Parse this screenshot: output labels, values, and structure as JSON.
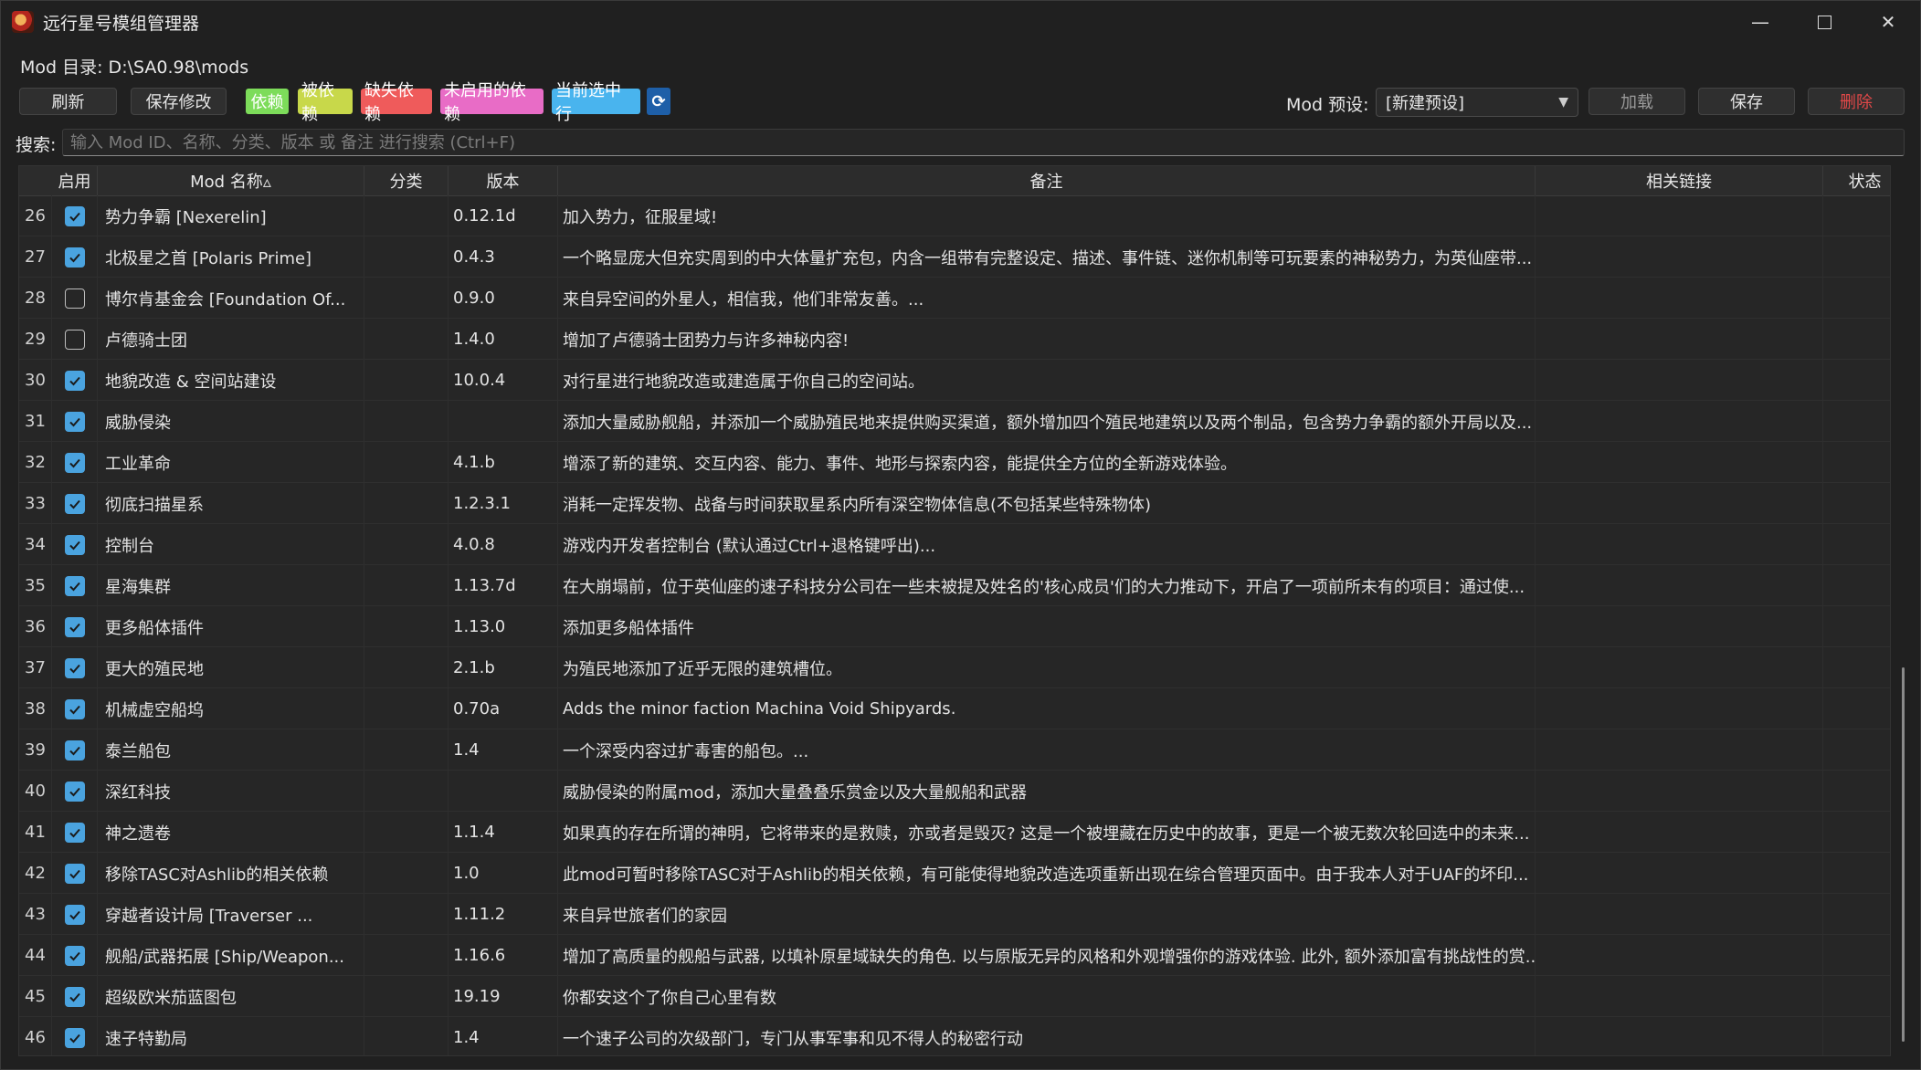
{
  "window": {
    "title": "远行星号模组管理器",
    "min_label": "—",
    "close_label": "✕"
  },
  "mod_dir": "Mod 目录: D:\\SA0.98\\mods",
  "toolbar": {
    "refresh_label": "刷新",
    "save_changes_label": "保存修改",
    "tags": [
      {
        "label": "依赖",
        "bg": "#7ddc5a",
        "fg": "#ffffff"
      },
      {
        "label": "被依赖",
        "bg": "#c8d84a",
        "fg": "#ffffff"
      },
      {
        "label": "缺失依赖",
        "bg": "#ef5b5b",
        "fg": "#ffffff"
      },
      {
        "label": "未启用的依赖",
        "bg": "#e86cc6",
        "fg": "#ffffff"
      },
      {
        "label": "当前选中行",
        "bg": "#49b4ee",
        "fg": "#ffffff"
      }
    ],
    "sync_icon": "refresh-icon"
  },
  "preset": {
    "label": "Mod 预设:",
    "selected": "[新建预设]",
    "load_label": "加载",
    "save_label": "保存",
    "delete_label": "删除",
    "delete_color": "#e04848"
  },
  "search": {
    "label": "搜索:",
    "placeholder": "输入 Mod ID、名称、分类、版本 或 备注 进行搜索 (Ctrl+F)"
  },
  "table": {
    "headers": {
      "enabled": "启用",
      "name": "Mod 名称▵",
      "category": "分类",
      "version": "版本",
      "note": "备注",
      "links": "相关链接",
      "status": "状态"
    },
    "rows": [
      {
        "idx": "26",
        "enabled": true,
        "name": "势力争霸 [Nexerelin]",
        "category": "",
        "version": "0.12.1d",
        "note": "加入势力，征服星域!",
        "links": "",
        "status": ""
      },
      {
        "idx": "27",
        "enabled": true,
        "name": "北极星之首 [Polaris Prime]",
        "category": "",
        "version": "0.4.3",
        "note": "一个略显庞大但充实周到的中大体量扩充包，内含一组带有完整设定、描述、事件链、迷你机制等可玩要素的神秘势力，为英仙座带...",
        "links": "",
        "status": ""
      },
      {
        "idx": "28",
        "enabled": false,
        "name": "博尔肯基金会 [Foundation Of...",
        "category": "",
        "version": "0.9.0",
        "note": "来自异空间的外星人，相信我，他们非常友善。...",
        "links": "",
        "status": ""
      },
      {
        "idx": "29",
        "enabled": false,
        "name": "卢德骑士团",
        "category": "",
        "version": "1.4.0",
        "note": "增加了卢德骑士团势力与许多神秘内容!",
        "links": "",
        "status": ""
      },
      {
        "idx": "30",
        "enabled": true,
        "name": "地貌改造 & 空间站建设",
        "category": "",
        "version": "10.0.4",
        "note": "对行星进行地貌改造或建造属于你自己的空间站。",
        "links": "",
        "status": ""
      },
      {
        "idx": "31",
        "enabled": true,
        "name": "威胁侵染",
        "category": "",
        "version": "",
        "note": "添加大量威胁舰船，并添加一个威胁殖民地来提供购买渠道，额外增加四个殖民地建筑以及两个制品，包含势力争霸的额外开局以及...",
        "links": "",
        "status": ""
      },
      {
        "idx": "32",
        "enabled": true,
        "name": "工业革命",
        "category": "",
        "version": "4.1.b",
        "note": "增添了新的建筑、交互内容、能力、事件、地形与探索内容，能提供全方位的全新游戏体验。",
        "links": "",
        "status": ""
      },
      {
        "idx": "33",
        "enabled": true,
        "name": "彻底扫描星系",
        "category": "",
        "version": "1.2.3.1",
        "note": "消耗一定挥发物、战备与时间获取星系内所有深空物体信息(不包括某些特殊物体)",
        "links": "",
        "status": ""
      },
      {
        "idx": "34",
        "enabled": true,
        "name": "控制台",
        "category": "",
        "version": "4.0.8",
        "note": "游戏内开发者控制台 (默认通过Ctrl+退格键呼出)...",
        "links": "",
        "status": ""
      },
      {
        "idx": "35",
        "enabled": true,
        "name": "星海集群",
        "category": "",
        "version": "1.13.7d",
        "note": "在大崩塌前，位于英仙座的速子科技分公司在一些未被提及姓名的'核心成员'们的大力推动下，开启了一项前所未有的项目：通过使...",
        "links": "",
        "status": ""
      },
      {
        "idx": "36",
        "enabled": true,
        "name": "更多船体插件",
        "category": "",
        "version": "1.13.0",
        "note": "添加更多船体插件",
        "links": "",
        "status": ""
      },
      {
        "idx": "37",
        "enabled": true,
        "name": "更大的殖民地",
        "category": "",
        "version": "2.1.b",
        "note": "为殖民地添加了近乎无限的建筑槽位。",
        "links": "",
        "status": ""
      },
      {
        "idx": "38",
        "enabled": true,
        "name": "机械虚空船坞",
        "category": "",
        "version": "0.70a",
        "note": "Adds the minor faction Machina Void Shipyards.",
        "links": "",
        "status": ""
      },
      {
        "idx": "39",
        "enabled": true,
        "name": "泰兰船包",
        "category": "",
        "version": "1.4",
        "note": "一个深受内容过扩毒害的船包。...",
        "links": "",
        "status": ""
      },
      {
        "idx": "40",
        "enabled": true,
        "name": "深红科技",
        "category": "",
        "version": "",
        "note": "威胁侵染的附属mod，添加大量叠叠乐赏金以及大量舰船和武器",
        "links": "",
        "status": ""
      },
      {
        "idx": "41",
        "enabled": true,
        "name": "神之遗卷",
        "category": "",
        "version": "1.1.4",
        "note": "如果真的存在所谓的神明，它将带来的是救赎，亦或者是毁灭? 这是一个被埋藏在历史中的故事，更是一个被无数次轮回选中的未来...",
        "links": "",
        "status": ""
      },
      {
        "idx": "42",
        "enabled": true,
        "name": "移除TASC对Ashlib的相关依赖",
        "category": "",
        "version": "1.0",
        "note": "此mod可暂时移除TASC对于Ashlib的相关依赖，有可能使得地貌改造选项重新出现在综合管理页面中。由于我本人对于UAF的坏印...",
        "links": "",
        "status": ""
      },
      {
        "idx": "43",
        "enabled": true,
        "name": "穿越者设计局 [Traverser ...",
        "category": "",
        "version": "1.11.2",
        "note": "来自异世旅者们的家园",
        "links": "",
        "status": ""
      },
      {
        "idx": "44",
        "enabled": true,
        "name": "舰船/武器拓展 [Ship/Weapon...",
        "category": "",
        "version": "1.16.6",
        "note": "增加了高质量的舰船与武器, 以填补原星域缺失的角色. 以与原版无异的风格和外观增强你的游戏体验. 此外, 额外添加富有挑战性的赏...",
        "links": "",
        "status": ""
      },
      {
        "idx": "45",
        "enabled": true,
        "name": "超级欧米茄蓝图包",
        "category": "",
        "version": "19.19",
        "note": "你都安这个了你自己心里有数",
        "links": "",
        "status": ""
      },
      {
        "idx": "46",
        "enabled": true,
        "name": "速子特勤局",
        "category": "",
        "version": "1.4",
        "note": "一个速子公司的次级部门，专门从事军事和见不得人的秘密行动",
        "links": "",
        "status": ""
      }
    ]
  }
}
